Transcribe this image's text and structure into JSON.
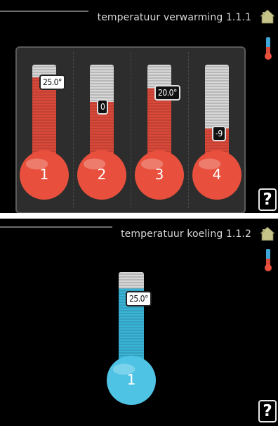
{
  "screens": [
    {
      "title": "temperatuur verwarming 1.1.1",
      "help_label": "?",
      "zones": [
        {
          "number": "1",
          "value_text": "25.0°",
          "level": 0.87,
          "selected": true
        },
        {
          "number": "2",
          "value_text": "0",
          "level": 0.62,
          "selected": false
        },
        {
          "number": "3",
          "value_text": "20.0°",
          "level": 0.76,
          "selected": false
        },
        {
          "number": "4",
          "value_text": "-9",
          "level": 0.35,
          "selected": false
        }
      ],
      "mode": "heating"
    },
    {
      "title": "temperatuur koeling 1.1.2",
      "help_label": "?",
      "zones": [
        {
          "number": "1",
          "value_text": "25.0°",
          "level": 0.83,
          "selected": true
        }
      ],
      "mode": "cooling"
    }
  ],
  "colors": {
    "heating_fill": "#d9493a",
    "heating_bulb": "#e8503d",
    "cooling_fill": "#3ab4d6",
    "cooling_bulb": "#4ec3e4",
    "empty_tube": "#d7d7d7",
    "house_icon": "#c7c48a"
  },
  "icons": {
    "home": "house-icon",
    "mode": "thermometer-icon",
    "help": "help-icon"
  }
}
